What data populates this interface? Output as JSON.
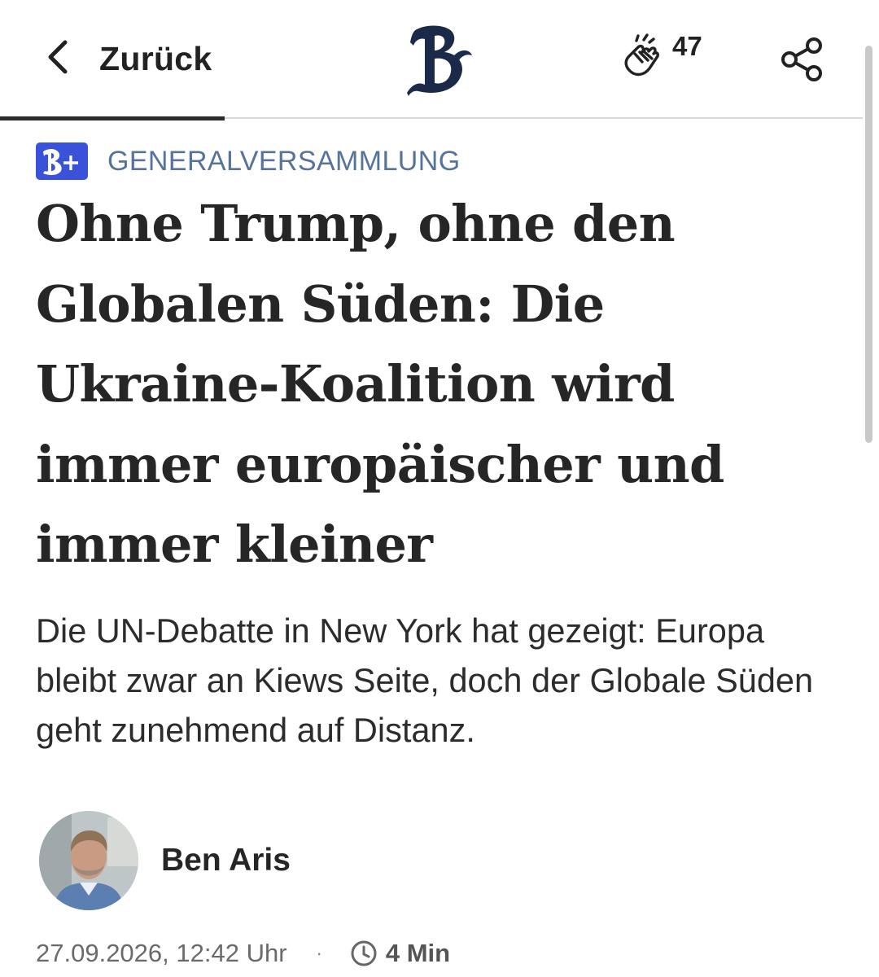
{
  "header": {
    "back_label": "Zurück",
    "logo_icon": "berliner-zeitung-b-logo-icon",
    "clap_count": "47",
    "clap_icon": "clapping-hands-icon",
    "share_icon": "share-icon"
  },
  "article": {
    "plus_badge_icon": "b-plus-premium-icon",
    "kicker": "GENERALVERSAMMLUNG",
    "headline": "Ohne Trump, ohne den Globalen Süden: Die Ukraine-Koalition wird immer europäischer und immer kleiner",
    "teaser": "Die UN-Debatte in New York hat gezeigt: Europa bleibt zwar an Kiews Seite, doch der Globale Süden geht zunehmend auf Distanz.",
    "author": {
      "name": "Ben Aris"
    },
    "meta": {
      "date": "27.09.2026, 12:42 Uhr",
      "separator": "·",
      "read_time": "4 Min",
      "clock_icon": "clock-icon"
    }
  },
  "colors": {
    "accent": "#3a52d9",
    "kicker": "#55739b",
    "logo": "#1c2a4a"
  }
}
